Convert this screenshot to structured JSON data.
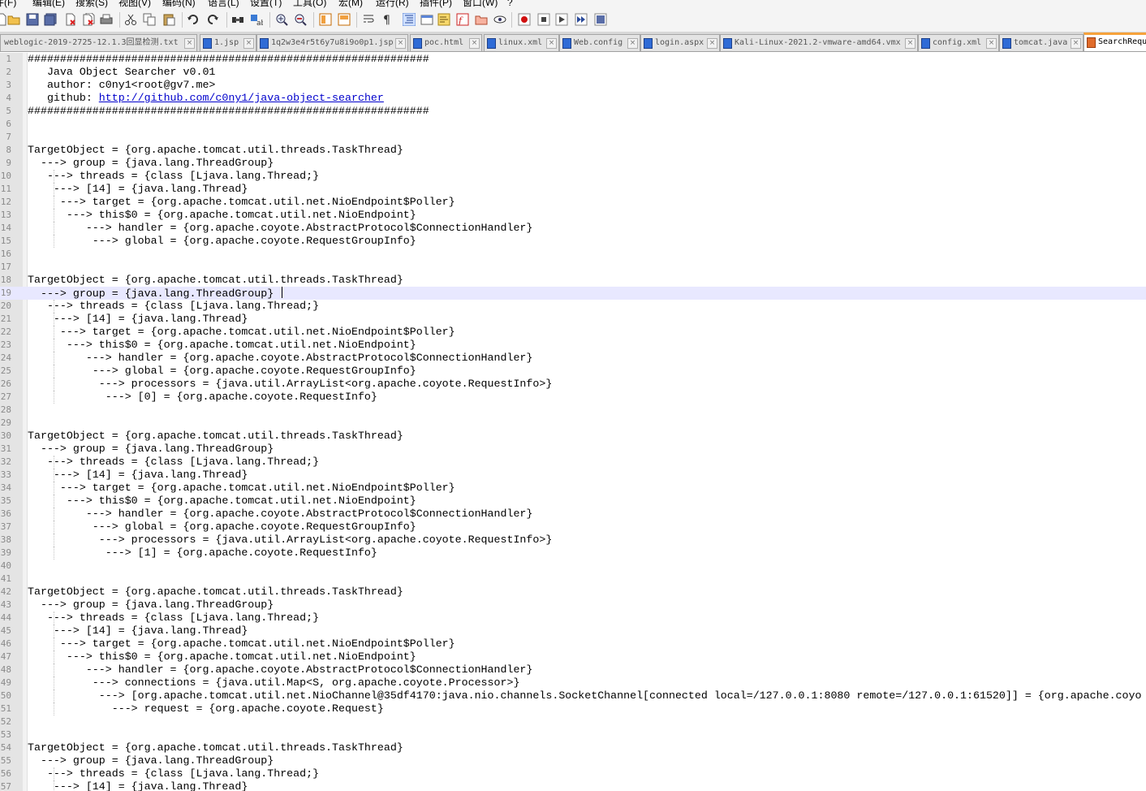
{
  "menubar": {
    "items": [
      "件(F)",
      "编辑(E)",
      "搜索(S)",
      "视图(V)",
      "编码(N)",
      "语言(L)",
      "设置(T)",
      "工具(O)",
      "宏(M)",
      "运行(R)",
      "插件(P)",
      "窗口(W)",
      "?"
    ]
  },
  "toolbar": {
    "buttons": [
      "new-file-icon",
      "open-file-icon",
      "save-icon",
      "save-all-icon",
      "close-icon",
      "close-all-icon",
      "print-icon",
      "cut-icon",
      "copy-icon",
      "paste-icon",
      "undo-icon",
      "redo-icon",
      "find-icon",
      "replace-icon",
      "zoom-in-icon",
      "zoom-out-icon",
      "sync-vertical-icon",
      "sync-horizontal-icon",
      "word-wrap-icon",
      "show-all-chars-icon",
      "indent-guide-icon",
      "user-language-icon",
      "doc-map-icon",
      "function-list-icon",
      "folder-workspace-icon",
      "monitoring-icon",
      "record-macro-icon",
      "stop-record-icon",
      "play-macro-icon",
      "run-macro-multiple-icon",
      "save-macro-icon"
    ]
  },
  "tabs": [
    {
      "label": "weblogic-2019-2725-12.1.3回显检测.txt",
      "active": false
    },
    {
      "label": "1.jsp",
      "active": false
    },
    {
      "label": "1q2w3e4r5t6y7u8i9o0p1.jsp",
      "active": false
    },
    {
      "label": "poc.html",
      "active": false
    },
    {
      "label": "linux.xml",
      "active": false
    },
    {
      "label": "Web.config",
      "active": false
    },
    {
      "label": "login.aspx",
      "active": false
    },
    {
      "label": "Kali-Linux-2021.2-vmware-amd64.vmx",
      "active": false
    },
    {
      "label": "config.xml",
      "active": false
    },
    {
      "label": "tomcat.java",
      "active": false
    },
    {
      "label": "SearchRequ",
      "active": true
    }
  ],
  "editor": {
    "current_line": 19,
    "first_line_number": 1,
    "lines": [
      {
        "text": "##############################################################"
      },
      {
        "text": "   Java Object Searcher v0.01"
      },
      {
        "text": "   author: c0ny1<root@gv7.me>"
      },
      {
        "text": "   github: ",
        "link": "http://github.com/c0ny1/java-object-searcher"
      },
      {
        "text": "##############################################################"
      },
      {
        "text": ""
      },
      {
        "text": ""
      },
      {
        "text": "TargetObject = {org.apache.tomcat.util.threads.TaskThread}"
      },
      {
        "text": "  ---> group = {java.lang.ThreadGroup}"
      },
      {
        "text": "   ---> threads = {class [Ljava.lang.Thread;}"
      },
      {
        "text": "    ---> [14] = {java.lang.Thread}"
      },
      {
        "text": "     ---> target = {org.apache.tomcat.util.net.NioEndpoint$Poller}"
      },
      {
        "text": "      ---> this$0 = {org.apache.tomcat.util.net.NioEndpoint}"
      },
      {
        "text": "         ---> handler = {org.apache.coyote.AbstractProtocol$ConnectionHandler}"
      },
      {
        "text": "          ---> global = {org.apache.coyote.RequestGroupInfo}"
      },
      {
        "text": ""
      },
      {
        "text": ""
      },
      {
        "text": "TargetObject = {org.apache.tomcat.util.threads.TaskThread}"
      },
      {
        "text": "  ---> group = {java.lang.ThreadGroup} "
      },
      {
        "text": "   ---> threads = {class [Ljava.lang.Thread;}"
      },
      {
        "text": "    ---> [14] = {java.lang.Thread}"
      },
      {
        "text": "     ---> target = {org.apache.tomcat.util.net.NioEndpoint$Poller}"
      },
      {
        "text": "      ---> this$0 = {org.apache.tomcat.util.net.NioEndpoint}"
      },
      {
        "text": "         ---> handler = {org.apache.coyote.AbstractProtocol$ConnectionHandler}"
      },
      {
        "text": "          ---> global = {org.apache.coyote.RequestGroupInfo}"
      },
      {
        "text": "           ---> processors = {java.util.ArrayList<org.apache.coyote.RequestInfo>}"
      },
      {
        "text": "            ---> [0] = {org.apache.coyote.RequestInfo}"
      },
      {
        "text": ""
      },
      {
        "text": ""
      },
      {
        "text": "TargetObject = {org.apache.tomcat.util.threads.TaskThread}"
      },
      {
        "text": "  ---> group = {java.lang.ThreadGroup}"
      },
      {
        "text": "   ---> threads = {class [Ljava.lang.Thread;}"
      },
      {
        "text": "    ---> [14] = {java.lang.Thread}"
      },
      {
        "text": "     ---> target = {org.apache.tomcat.util.net.NioEndpoint$Poller}"
      },
      {
        "text": "      ---> this$0 = {org.apache.tomcat.util.net.NioEndpoint}"
      },
      {
        "text": "         ---> handler = {org.apache.coyote.AbstractProtocol$ConnectionHandler}"
      },
      {
        "text": "          ---> global = {org.apache.coyote.RequestGroupInfo}"
      },
      {
        "text": "           ---> processors = {java.util.ArrayList<org.apache.coyote.RequestInfo>}"
      },
      {
        "text": "            ---> [1] = {org.apache.coyote.RequestInfo}"
      },
      {
        "text": ""
      },
      {
        "text": ""
      },
      {
        "text": "TargetObject = {org.apache.tomcat.util.threads.TaskThread}"
      },
      {
        "text": "  ---> group = {java.lang.ThreadGroup}"
      },
      {
        "text": "   ---> threads = {class [Ljava.lang.Thread;}"
      },
      {
        "text": "    ---> [14] = {java.lang.Thread}"
      },
      {
        "text": "     ---> target = {org.apache.tomcat.util.net.NioEndpoint$Poller}"
      },
      {
        "text": "      ---> this$0 = {org.apache.tomcat.util.net.NioEndpoint}"
      },
      {
        "text": "         ---> handler = {org.apache.coyote.AbstractProtocol$ConnectionHandler}"
      },
      {
        "text": "          ---> connections = {java.util.Map<S, org.apache.coyote.Processor>}"
      },
      {
        "text": "           ---> [org.apache.tomcat.util.net.NioChannel@35df4170:java.nio.channels.SocketChannel[connected local=/127.0.0.1:8080 remote=/127.0.0.1:61520]] = {org.apache.coyo"
      },
      {
        "text": "             ---> request = {org.apache.coyote.Request}"
      },
      {
        "text": ""
      },
      {
        "text": ""
      },
      {
        "text": "TargetObject = {org.apache.tomcat.util.threads.TaskThread}"
      },
      {
        "text": "  ---> group = {java.lang.ThreadGroup}"
      },
      {
        "text": "   ---> threads = {class [Ljava.lang.Thread;}"
      },
      {
        "text": "    ---> [14] = {java.lang.Thread}"
      }
    ]
  }
}
